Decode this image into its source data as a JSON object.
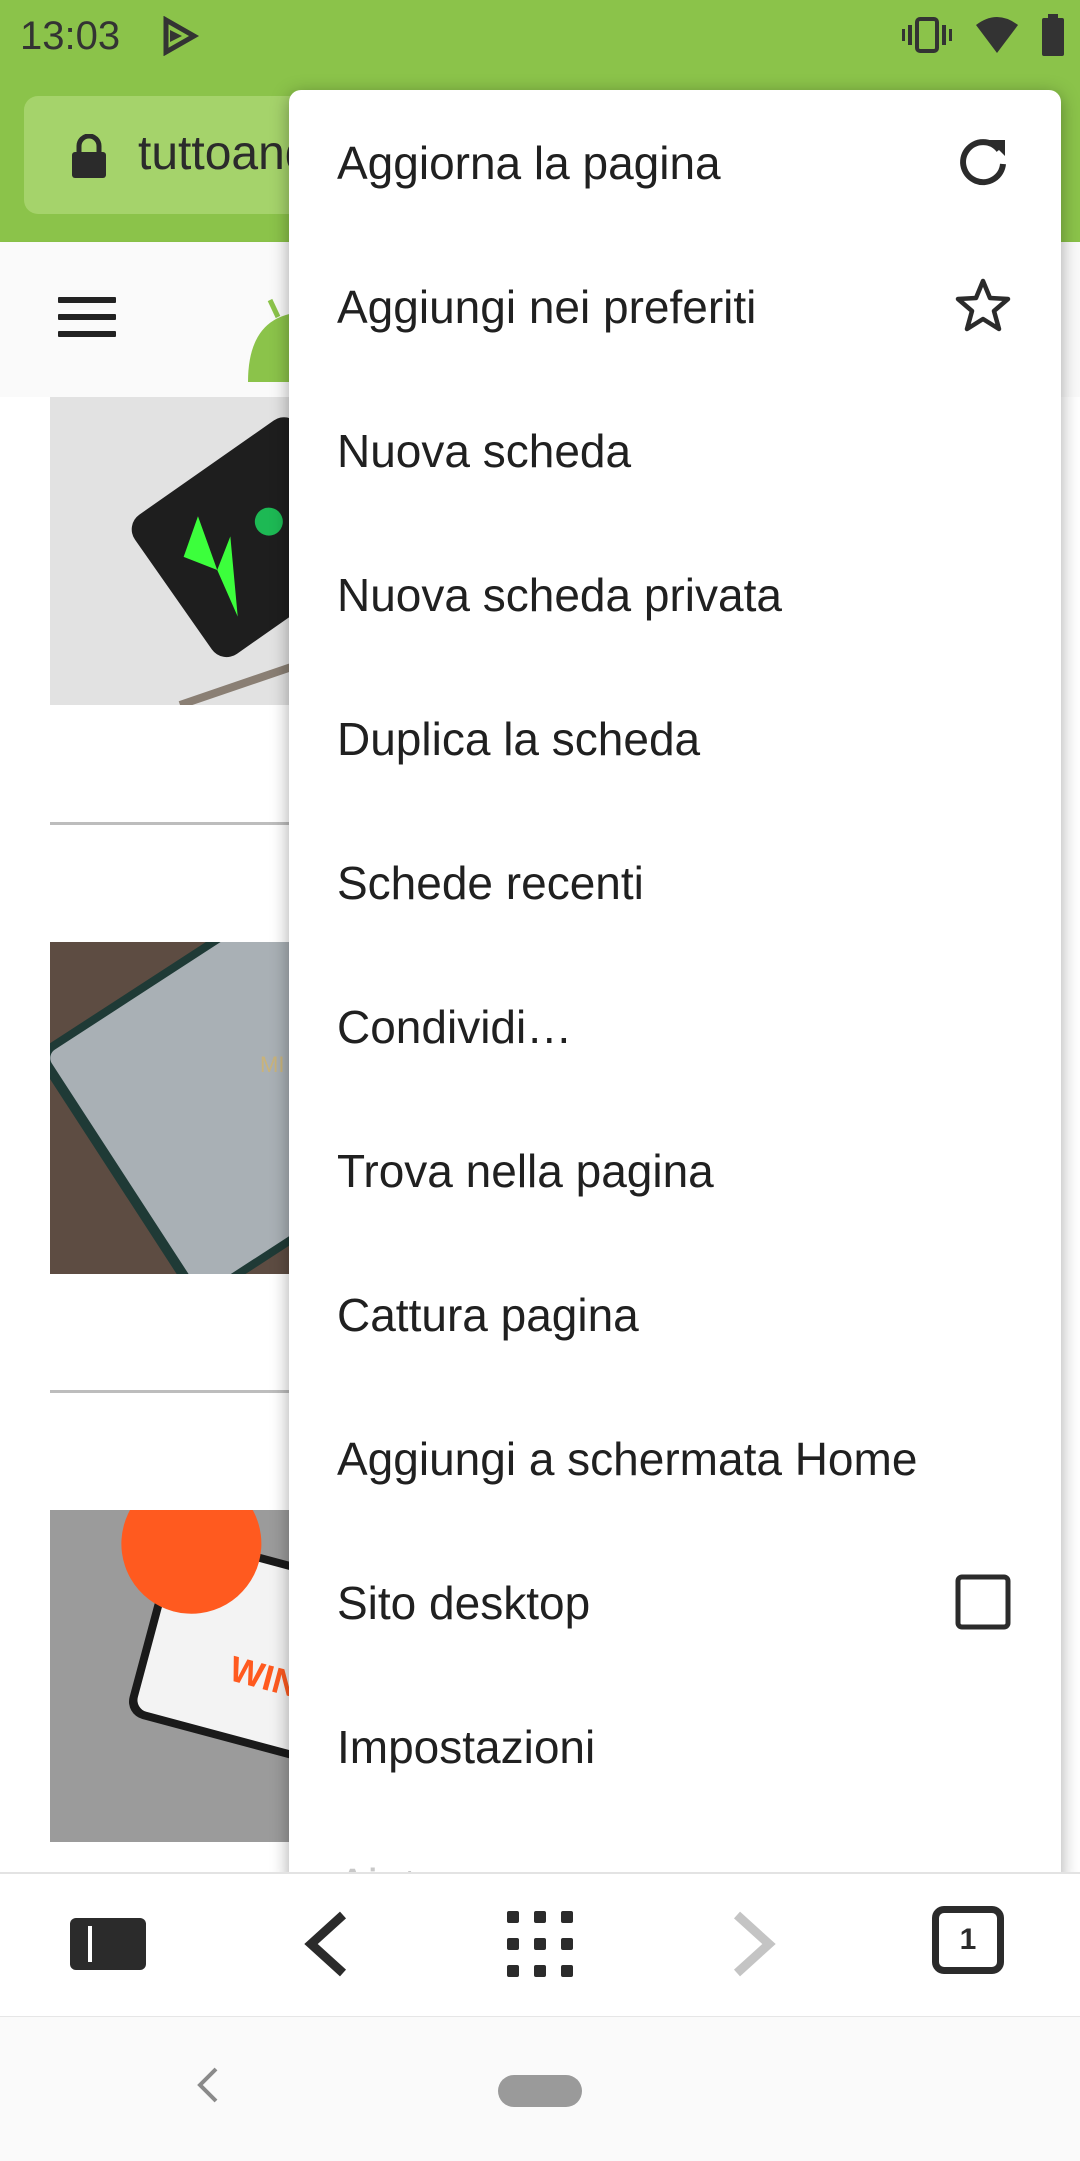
{
  "status_bar": {
    "time": "13:03"
  },
  "address_bar": {
    "url": "tuttoandroid.net"
  },
  "menu": {
    "items": [
      {
        "label": "Aggiorna la pagina",
        "trailing_icon": "refresh-icon"
      },
      {
        "label": "Aggiungi nei preferiti",
        "trailing_icon": "star-outline-icon"
      },
      {
        "label": "Nuova scheda"
      },
      {
        "label": "Nuova scheda privata"
      },
      {
        "label": "Duplica la scheda"
      },
      {
        "label": "Schede recenti"
      },
      {
        "label": "Condividi…"
      },
      {
        "label": "Trova nella pagina"
      },
      {
        "label": "Cattura pagina"
      },
      {
        "label": "Aggiungi a schermata Home"
      },
      {
        "label": "Sito desktop",
        "checkbox_checked": false
      },
      {
        "label": "Impostazioni"
      },
      {
        "label": "Aiuto"
      }
    ]
  },
  "bottom_toolbar": {
    "tab_count": "1"
  },
  "colors": {
    "accent": "#8bc34a",
    "accent_light": "#a5d36b",
    "icon": "#2b2b2b"
  }
}
